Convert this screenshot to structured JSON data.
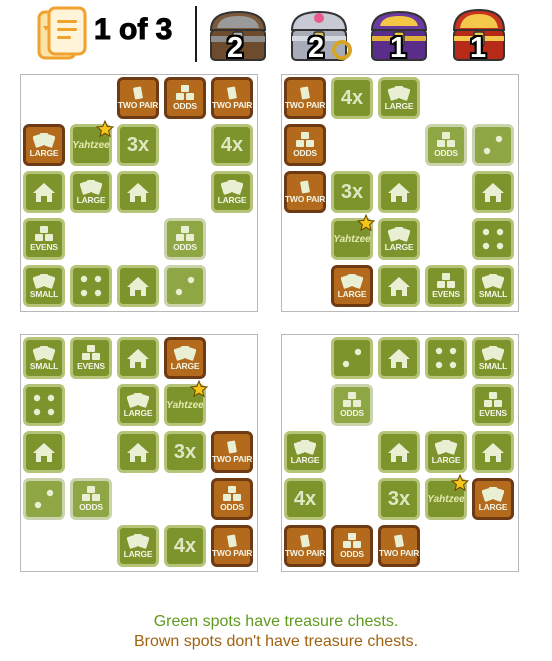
{
  "header": {
    "page_count": "1 of 3",
    "chests": [
      {
        "name": "iron-chest-icon",
        "count": "2"
      },
      {
        "name": "silver-chest-icon",
        "count": "2"
      },
      {
        "name": "purple-chest-icon",
        "count": "1"
      },
      {
        "name": "gold-chest-icon",
        "count": "1"
      }
    ]
  },
  "labels": {
    "two_pair": "TWO PAIR",
    "odds": "ODDS",
    "evens": "EVENS",
    "large": "LARGE",
    "small": "SMALL",
    "three_x": "3x",
    "four_x": "4x",
    "yahtzee": "Yahtzee"
  },
  "boards": [
    {
      "tiles": [
        {
          "r": 0,
          "c": 2,
          "type": "two_pair",
          "color": "brown"
        },
        {
          "r": 0,
          "c": 3,
          "type": "odds",
          "color": "brown"
        },
        {
          "r": 0,
          "c": 4,
          "type": "two_pair",
          "color": "brown"
        },
        {
          "r": 1,
          "c": 0,
          "type": "large",
          "color": "brown"
        },
        {
          "r": 1,
          "c": 1,
          "type": "yahtzee",
          "color": "green",
          "star": true
        },
        {
          "r": 1,
          "c": 2,
          "type": "three_x",
          "color": "green"
        },
        {
          "r": 1,
          "c": 4,
          "type": "four_x",
          "color": "green"
        },
        {
          "r": 2,
          "c": 0,
          "type": "house",
          "color": "green"
        },
        {
          "r": 2,
          "c": 1,
          "type": "large",
          "color": "green"
        },
        {
          "r": 2,
          "c": 2,
          "type": "house",
          "color": "green"
        },
        {
          "r": 2,
          "c": 4,
          "type": "large",
          "color": "green"
        },
        {
          "r": 3,
          "c": 0,
          "type": "evens",
          "color": "green"
        },
        {
          "r": 3,
          "c": 3,
          "type": "odds",
          "color": "faded"
        },
        {
          "r": 4,
          "c": 0,
          "type": "small",
          "color": "green"
        },
        {
          "r": 4,
          "c": 1,
          "type": "four_dots",
          "color": "green"
        },
        {
          "r": 4,
          "c": 2,
          "type": "house",
          "color": "green"
        },
        {
          "r": 4,
          "c": 3,
          "type": "two_dots",
          "color": "faded"
        }
      ]
    },
    {
      "tiles": [
        {
          "r": 0,
          "c": 0,
          "type": "two_pair",
          "color": "brown"
        },
        {
          "r": 0,
          "c": 1,
          "type": "four_x",
          "color": "green"
        },
        {
          "r": 0,
          "c": 2,
          "type": "large",
          "color": "green"
        },
        {
          "r": 1,
          "c": 0,
          "type": "odds",
          "color": "brown"
        },
        {
          "r": 1,
          "c": 3,
          "type": "odds",
          "color": "faded"
        },
        {
          "r": 1,
          "c": 4,
          "type": "two_dots",
          "color": "faded"
        },
        {
          "r": 2,
          "c": 0,
          "type": "two_pair",
          "color": "brown"
        },
        {
          "r": 2,
          "c": 1,
          "type": "three_x",
          "color": "green"
        },
        {
          "r": 2,
          "c": 2,
          "type": "house",
          "color": "green"
        },
        {
          "r": 2,
          "c": 4,
          "type": "house",
          "color": "green"
        },
        {
          "r": 3,
          "c": 1,
          "type": "yahtzee",
          "color": "green",
          "star": true
        },
        {
          "r": 3,
          "c": 2,
          "type": "large",
          "color": "green"
        },
        {
          "r": 3,
          "c": 4,
          "type": "four_dots",
          "color": "green"
        },
        {
          "r": 4,
          "c": 1,
          "type": "large",
          "color": "brown"
        },
        {
          "r": 4,
          "c": 2,
          "type": "house",
          "color": "green"
        },
        {
          "r": 4,
          "c": 3,
          "type": "evens",
          "color": "green"
        },
        {
          "r": 4,
          "c": 4,
          "type": "small",
          "color": "green"
        }
      ]
    },
    {
      "tiles": [
        {
          "r": 0,
          "c": 0,
          "type": "small",
          "color": "green"
        },
        {
          "r": 0,
          "c": 1,
          "type": "evens",
          "color": "green"
        },
        {
          "r": 0,
          "c": 2,
          "type": "house",
          "color": "green"
        },
        {
          "r": 0,
          "c": 3,
          "type": "large",
          "color": "brown"
        },
        {
          "r": 1,
          "c": 0,
          "type": "four_dots",
          "color": "green"
        },
        {
          "r": 1,
          "c": 2,
          "type": "large",
          "color": "green"
        },
        {
          "r": 1,
          "c": 3,
          "type": "yahtzee",
          "color": "green",
          "star": true
        },
        {
          "r": 2,
          "c": 0,
          "type": "house",
          "color": "green"
        },
        {
          "r": 2,
          "c": 2,
          "type": "house",
          "color": "green"
        },
        {
          "r": 2,
          "c": 3,
          "type": "three_x",
          "color": "green"
        },
        {
          "r": 2,
          "c": 4,
          "type": "two_pair",
          "color": "brown"
        },
        {
          "r": 3,
          "c": 0,
          "type": "two_dots",
          "color": "faded"
        },
        {
          "r": 3,
          "c": 1,
          "type": "odds",
          "color": "faded"
        },
        {
          "r": 3,
          "c": 4,
          "type": "odds",
          "color": "brown"
        },
        {
          "r": 4,
          "c": 2,
          "type": "large",
          "color": "green"
        },
        {
          "r": 4,
          "c": 3,
          "type": "four_x",
          "color": "green"
        },
        {
          "r": 4,
          "c": 4,
          "type": "two_pair",
          "color": "brown"
        }
      ]
    },
    {
      "tiles": [
        {
          "r": 0,
          "c": 1,
          "type": "two_dots",
          "color": "green"
        },
        {
          "r": 0,
          "c": 2,
          "type": "house",
          "color": "green"
        },
        {
          "r": 0,
          "c": 3,
          "type": "four_dots",
          "color": "green"
        },
        {
          "r": 0,
          "c": 4,
          "type": "small",
          "color": "green"
        },
        {
          "r": 1,
          "c": 1,
          "type": "odds",
          "color": "faded"
        },
        {
          "r": 1,
          "c": 4,
          "type": "evens",
          "color": "green"
        },
        {
          "r": 2,
          "c": 0,
          "type": "large",
          "color": "green"
        },
        {
          "r": 2,
          "c": 2,
          "type": "house",
          "color": "green"
        },
        {
          "r": 2,
          "c": 3,
          "type": "large",
          "color": "green"
        },
        {
          "r": 2,
          "c": 4,
          "type": "house",
          "color": "green"
        },
        {
          "r": 3,
          "c": 0,
          "type": "four_x",
          "color": "green"
        },
        {
          "r": 3,
          "c": 2,
          "type": "three_x",
          "color": "green"
        },
        {
          "r": 3,
          "c": 3,
          "type": "yahtzee",
          "color": "green",
          "star": true
        },
        {
          "r": 3,
          "c": 4,
          "type": "large",
          "color": "brown"
        },
        {
          "r": 4,
          "c": 0,
          "type": "two_pair",
          "color": "brown"
        },
        {
          "r": 4,
          "c": 1,
          "type": "odds",
          "color": "brown"
        },
        {
          "r": 4,
          "c": 2,
          "type": "two_pair",
          "color": "brown"
        }
      ]
    }
  ],
  "footer": {
    "green_line": "Green spots have treasure chests.",
    "brown_line": "Brown spots don't have treasure chests.",
    "green_color": "#5f9a1e",
    "brown_color": "#a0620f"
  }
}
